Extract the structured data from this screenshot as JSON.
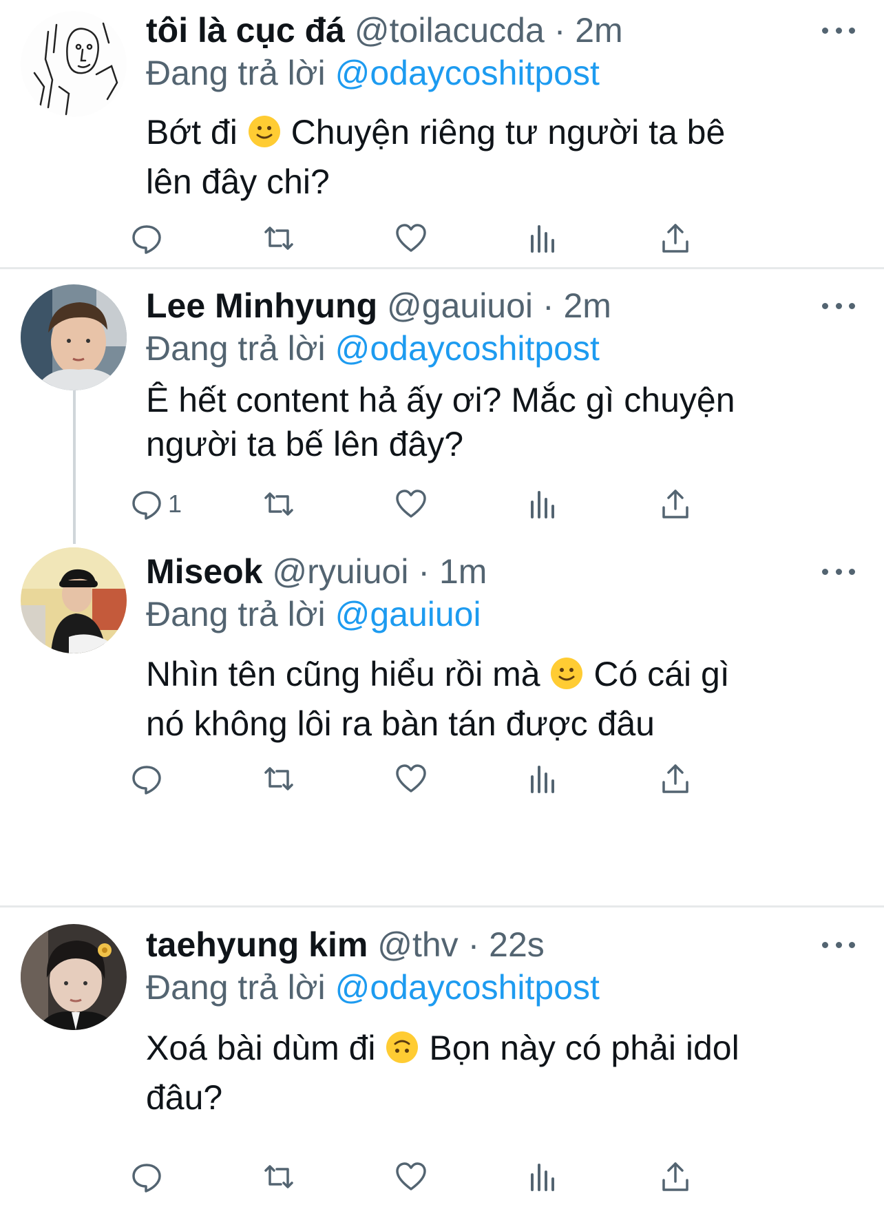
{
  "tweets": [
    {
      "display_name": "tôi là cục đá",
      "handle": "@toilacucda",
      "separator": "·",
      "time": "2m",
      "reply_prefix": "Đang trả lời",
      "reply_to": "@odaycoshitpost",
      "text_lines": [
        {
          "before": "Bớt đi",
          "emoji": "slightly-smiling-face",
          "after": "Chuyện riêng tư người ta bê"
        },
        {
          "before": "lên đây chi?",
          "emoji": "",
          "after": ""
        }
      ],
      "reply_count": ""
    },
    {
      "display_name": "Lee Minhyung",
      "handle": "@gauiuoi",
      "separator": "·",
      "time": "2m",
      "reply_prefix": "Đang trả lời",
      "reply_to": "@odaycoshitpost",
      "text_lines": [
        {
          "before": "Ê hết content hả ấy ơi? Mắc gì chuyện",
          "emoji": "",
          "after": ""
        },
        {
          "before": "người ta bế lên đây?",
          "emoji": "",
          "after": ""
        }
      ],
      "reply_count": "1"
    },
    {
      "display_name": "Miseok",
      "handle": "@ryuiuoi",
      "separator": "·",
      "time": "1m",
      "reply_prefix": "Đang trả lời",
      "reply_to": "@gauiuoi",
      "text_lines": [
        {
          "before": "Nhìn tên cũng hiểu rồi mà",
          "emoji": "slightly-smiling-face",
          "after": "Có cái gì"
        },
        {
          "before": "nó không lôi ra bàn tán được đâu",
          "emoji": "",
          "after": ""
        }
      ],
      "reply_count": ""
    },
    {
      "display_name": "taehyung kim",
      "handle": "@thv",
      "separator": "·",
      "time": "22s",
      "reply_prefix": "Đang trả lời",
      "reply_to": "@odaycoshitpost",
      "text_lines": [
        {
          "before": "Xoá bài dùm đi",
          "emoji": "upside-down-face",
          "after": "Bọn này có phải idol"
        },
        {
          "before": "đâu?",
          "emoji": "",
          "after": ""
        }
      ],
      "reply_count": ""
    }
  ],
  "action_icons": [
    "reply-icon",
    "retweet-icon",
    "like-icon",
    "views-icon",
    "share-icon"
  ],
  "colors": {
    "link": "#1d9bf0",
    "secondary_text": "#536471",
    "primary_text": "#0f1419",
    "divider": "#e6e9ea",
    "emoji": "#ffcc33"
  }
}
